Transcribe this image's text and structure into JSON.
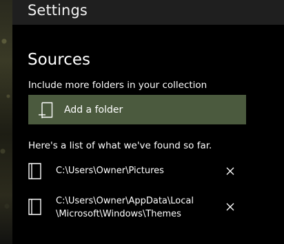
{
  "header": {
    "title": "Settings"
  },
  "sources": {
    "title": "Sources",
    "include_label": "Include more folders in your collection",
    "add_folder_label": "Add a folder",
    "found_label": "Here's a list of what we've found so far.",
    "folders": [
      {
        "path": "C:\\Users\\Owner\\Pictures"
      },
      {
        "path": "C:\\Users\\Owner\\AppData\\Local\n\\Microsoft\\Windows\\Themes"
      }
    ]
  },
  "icons": {
    "add_folder": "add-folder-icon",
    "folder": "folder-icon",
    "remove": "close-icon"
  },
  "colors": {
    "background": "#000000",
    "header_bg": "#1f1f1f",
    "accent_button": "#4b5a3e",
    "text": "#ffffff"
  }
}
